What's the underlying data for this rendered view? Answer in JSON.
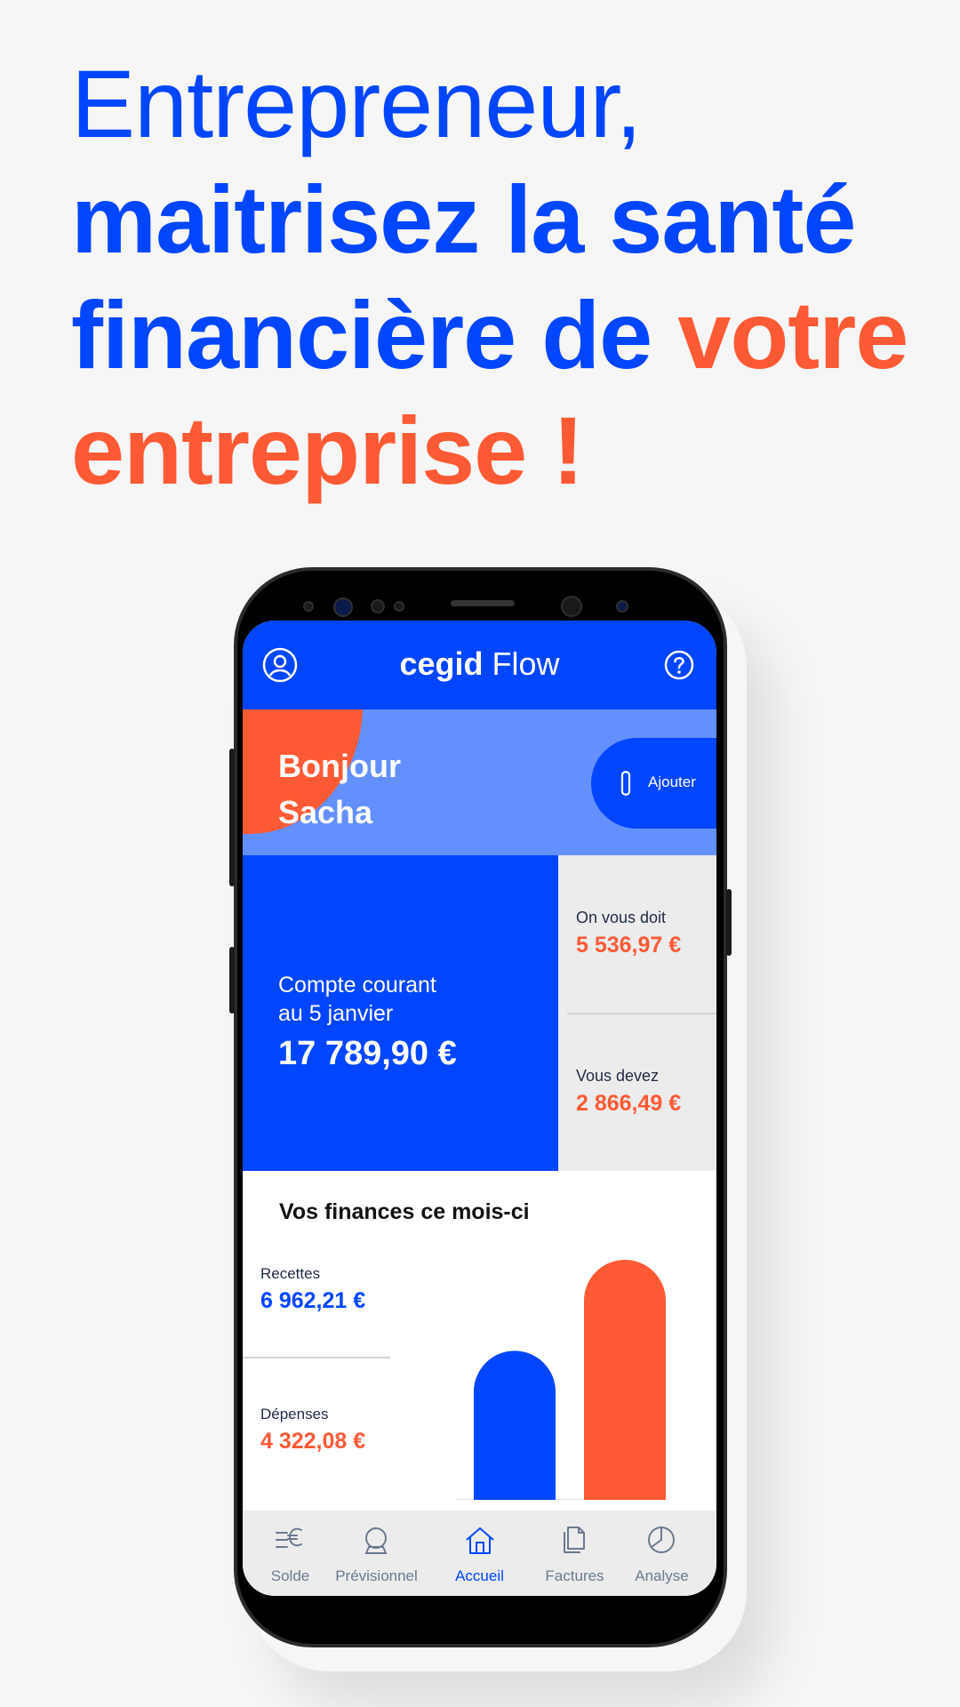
{
  "headline": {
    "line1": "Entrepreneur,",
    "line2": "maitrisez la santé",
    "line3a": "financière de ",
    "line3b": "votre",
    "line4": "entreprise !"
  },
  "app": {
    "brand_bold": "cegid",
    "brand_light": "Flow",
    "greeting_line1": "Bonjour",
    "greeting_line2": "Sacha",
    "add_label": "Ajouter"
  },
  "account": {
    "label_line1": "Compte courant",
    "label_line2": "au 5 janvier",
    "amount": "17 789,90 €"
  },
  "receivables": {
    "owed_to_you_label": "On vous doit",
    "owed_to_you_value": "5 536,97 €",
    "you_owe_label": "Vous devez",
    "you_owe_value": "2 866,49 €"
  },
  "finances": {
    "title": "Vos finances ce mois-ci",
    "income_label": "Recettes",
    "income_value": "6 962,21 €",
    "expense_label": "Dépenses",
    "expense_value": "4 322,08 €"
  },
  "chart_data": {
    "type": "bar",
    "values": [
      4322.08,
      6962.21
    ],
    "colors": [
      "#0046fe",
      "#ff5a36"
    ]
  },
  "nav": [
    {
      "label": "Solde",
      "icon": "balance-euro-icon",
      "active": false
    },
    {
      "label": "Prévisionnel",
      "icon": "crystal-ball-icon",
      "active": false
    },
    {
      "label": "Accueil",
      "icon": "home-icon",
      "active": true
    },
    {
      "label": "Factures",
      "icon": "documents-icon",
      "active": false
    },
    {
      "label": "Analyse",
      "icon": "pie-chart-icon",
      "active": false
    }
  ],
  "colors": {
    "brand_blue": "#0046fe",
    "accent_orange": "#ff5a36",
    "light_blue": "#6490ff"
  }
}
